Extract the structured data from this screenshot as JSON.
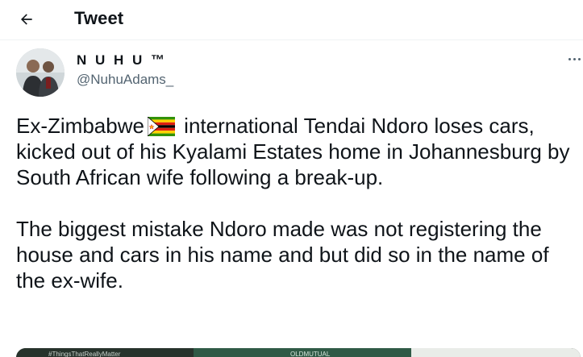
{
  "header": {
    "title": "Tweet",
    "back_icon": "back-arrow-icon"
  },
  "author": {
    "display_name": "N U H U ™",
    "handle": "@NuhuAdams_",
    "more_icon": "more-options-icon"
  },
  "tweet": {
    "text_before_flag": "Ex-Zimbabwe",
    "flag_icon": "zimbabwe-flag-icon",
    "text_after_flag": " international Tendai Ndoro loses cars, kicked out of his Kyalami Estates home in Johannesburg by South African wife following a break-up.",
    "paragraph_2": "The biggest mistake Ndoro made was not registering the house and cars in his name and but did so in the name of the ex-wife."
  },
  "media": {
    "caption_left": "#ThingsThatReallyMatter",
    "caption_right": "OLDMUTUAL"
  },
  "colors": {
    "text_primary": "#0f1419",
    "text_secondary": "#536471",
    "divider": "#eff3f4"
  }
}
